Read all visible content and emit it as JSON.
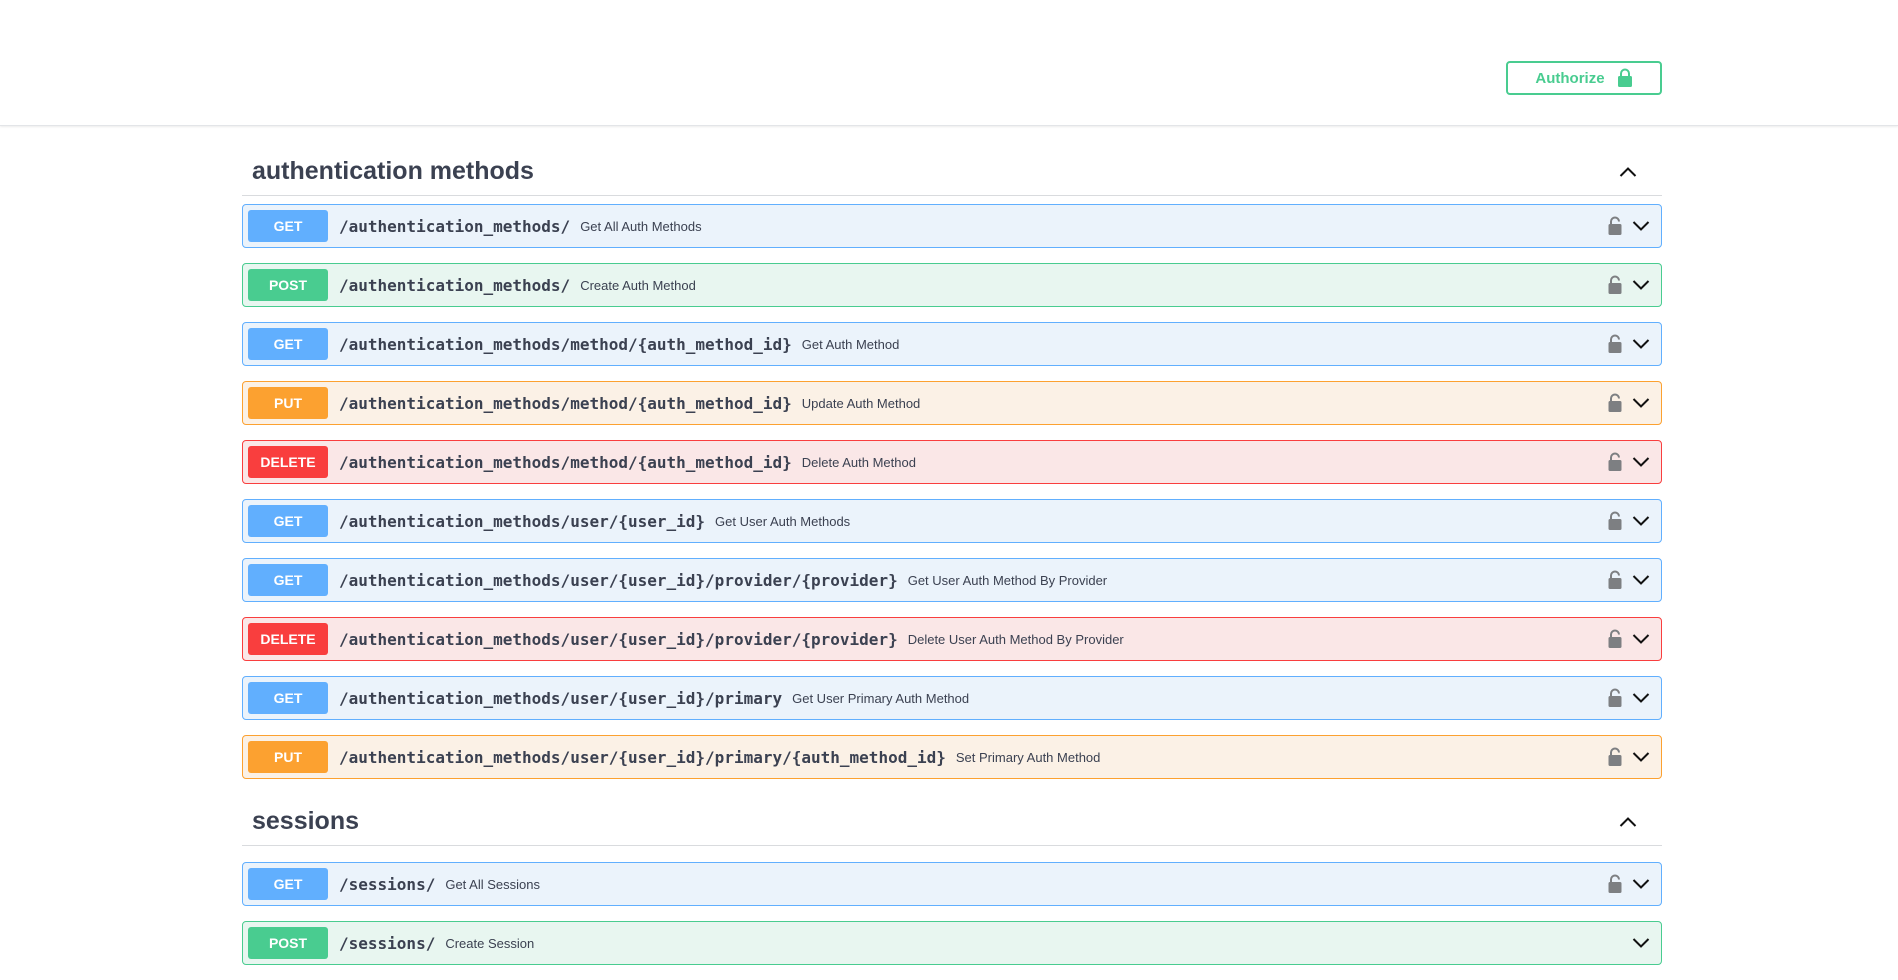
{
  "header": {
    "authorize_label": "Authorize",
    "authorize_icon": "lock-icon",
    "accent_color": "#49cc90"
  },
  "sections": [
    {
      "title": "authentication methods",
      "expanded": true,
      "operations": [
        {
          "method": "GET",
          "path": "/authentication_methods/",
          "summary": "Get All Auth Methods",
          "locked": true
        },
        {
          "method": "POST",
          "path": "/authentication_methods/",
          "summary": "Create Auth Method",
          "locked": true
        },
        {
          "method": "GET",
          "path": "/authentication_methods/method/{auth_method_id}",
          "summary": "Get Auth Method",
          "locked": true
        },
        {
          "method": "PUT",
          "path": "/authentication_methods/method/{auth_method_id}",
          "summary": "Update Auth Method",
          "locked": true
        },
        {
          "method": "DELETE",
          "path": "/authentication_methods/method/{auth_method_id}",
          "summary": "Delete Auth Method",
          "locked": true
        },
        {
          "method": "GET",
          "path": "/authentication_methods/user/{user_id}",
          "summary": "Get User Auth Methods",
          "locked": true
        },
        {
          "method": "GET",
          "path": "/authentication_methods/user/{user_id}/provider/{provider}",
          "summary": "Get User Auth Method By Provider",
          "locked": true
        },
        {
          "method": "DELETE",
          "path": "/authentication_methods/user/{user_id}/provider/{provider}",
          "summary": "Delete User Auth Method By Provider",
          "locked": true
        },
        {
          "method": "GET",
          "path": "/authentication_methods/user/{user_id}/primary",
          "summary": "Get User Primary Auth Method",
          "locked": true
        },
        {
          "method": "PUT",
          "path": "/authentication_methods/user/{user_id}/primary/{auth_method_id}",
          "summary": "Set Primary Auth Method",
          "locked": true
        }
      ]
    },
    {
      "title": "sessions",
      "expanded": true,
      "operations": [
        {
          "method": "GET",
          "path": "/sessions/",
          "summary": "Get All Sessions",
          "locked": true
        },
        {
          "method": "POST",
          "path": "/sessions/",
          "summary": "Create Session",
          "locked": false
        },
        {
          "method": "GET",
          "path": "",
          "summary": "",
          "locked": false
        }
      ]
    }
  ],
  "method_colors": {
    "GET": "#61affe",
    "POST": "#49cc90",
    "PUT": "#fca130",
    "DELETE": "#f93e3e"
  }
}
